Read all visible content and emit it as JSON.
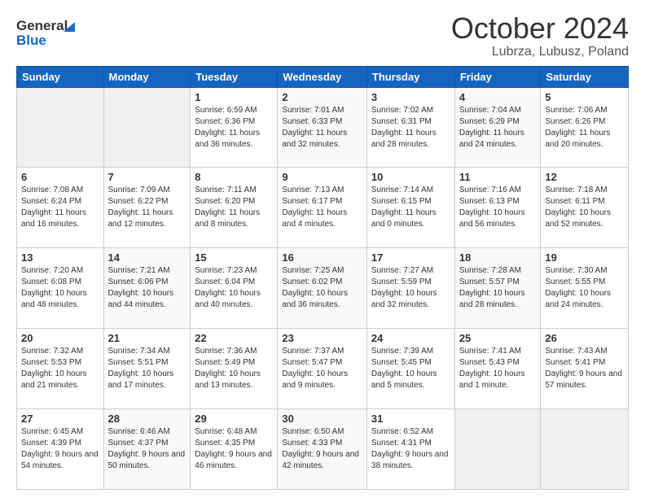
{
  "header": {
    "logo_general": "General",
    "logo_blue": "Blue",
    "title": "October 2024",
    "location": "Lubrza, Lubusz, Poland"
  },
  "days_of_week": [
    "Sunday",
    "Monday",
    "Tuesday",
    "Wednesday",
    "Thursday",
    "Friday",
    "Saturday"
  ],
  "weeks": [
    [
      {
        "day": "",
        "info": ""
      },
      {
        "day": "",
        "info": ""
      },
      {
        "day": "1",
        "info": "Sunrise: 6:59 AM\nSunset: 6:36 PM\nDaylight: 11 hours and 36 minutes."
      },
      {
        "day": "2",
        "info": "Sunrise: 7:01 AM\nSunset: 6:33 PM\nDaylight: 11 hours and 32 minutes."
      },
      {
        "day": "3",
        "info": "Sunrise: 7:02 AM\nSunset: 6:31 PM\nDaylight: 11 hours and 28 minutes."
      },
      {
        "day": "4",
        "info": "Sunrise: 7:04 AM\nSunset: 6:29 PM\nDaylight: 11 hours and 24 minutes."
      },
      {
        "day": "5",
        "info": "Sunrise: 7:06 AM\nSunset: 6:26 PM\nDaylight: 11 hours and 20 minutes."
      }
    ],
    [
      {
        "day": "6",
        "info": "Sunrise: 7:08 AM\nSunset: 6:24 PM\nDaylight: 11 hours and 16 minutes."
      },
      {
        "day": "7",
        "info": "Sunrise: 7:09 AM\nSunset: 6:22 PM\nDaylight: 11 hours and 12 minutes."
      },
      {
        "day": "8",
        "info": "Sunrise: 7:11 AM\nSunset: 6:20 PM\nDaylight: 11 hours and 8 minutes."
      },
      {
        "day": "9",
        "info": "Sunrise: 7:13 AM\nSunset: 6:17 PM\nDaylight: 11 hours and 4 minutes."
      },
      {
        "day": "10",
        "info": "Sunrise: 7:14 AM\nSunset: 6:15 PM\nDaylight: 11 hours and 0 minutes."
      },
      {
        "day": "11",
        "info": "Sunrise: 7:16 AM\nSunset: 6:13 PM\nDaylight: 10 hours and 56 minutes."
      },
      {
        "day": "12",
        "info": "Sunrise: 7:18 AM\nSunset: 6:11 PM\nDaylight: 10 hours and 52 minutes."
      }
    ],
    [
      {
        "day": "13",
        "info": "Sunrise: 7:20 AM\nSunset: 6:08 PM\nDaylight: 10 hours and 48 minutes."
      },
      {
        "day": "14",
        "info": "Sunrise: 7:21 AM\nSunset: 6:06 PM\nDaylight: 10 hours and 44 minutes."
      },
      {
        "day": "15",
        "info": "Sunrise: 7:23 AM\nSunset: 6:04 PM\nDaylight: 10 hours and 40 minutes."
      },
      {
        "day": "16",
        "info": "Sunrise: 7:25 AM\nSunset: 6:02 PM\nDaylight: 10 hours and 36 minutes."
      },
      {
        "day": "17",
        "info": "Sunrise: 7:27 AM\nSunset: 5:59 PM\nDaylight: 10 hours and 32 minutes."
      },
      {
        "day": "18",
        "info": "Sunrise: 7:28 AM\nSunset: 5:57 PM\nDaylight: 10 hours and 28 minutes."
      },
      {
        "day": "19",
        "info": "Sunrise: 7:30 AM\nSunset: 5:55 PM\nDaylight: 10 hours and 24 minutes."
      }
    ],
    [
      {
        "day": "20",
        "info": "Sunrise: 7:32 AM\nSunset: 5:53 PM\nDaylight: 10 hours and 21 minutes."
      },
      {
        "day": "21",
        "info": "Sunrise: 7:34 AM\nSunset: 5:51 PM\nDaylight: 10 hours and 17 minutes."
      },
      {
        "day": "22",
        "info": "Sunrise: 7:36 AM\nSunset: 5:49 PM\nDaylight: 10 hours and 13 minutes."
      },
      {
        "day": "23",
        "info": "Sunrise: 7:37 AM\nSunset: 5:47 PM\nDaylight: 10 hours and 9 minutes."
      },
      {
        "day": "24",
        "info": "Sunrise: 7:39 AM\nSunset: 5:45 PM\nDaylight: 10 hours and 5 minutes."
      },
      {
        "day": "25",
        "info": "Sunrise: 7:41 AM\nSunset: 5:43 PM\nDaylight: 10 hours and 1 minute."
      },
      {
        "day": "26",
        "info": "Sunrise: 7:43 AM\nSunset: 5:41 PM\nDaylight: 9 hours and 57 minutes."
      }
    ],
    [
      {
        "day": "27",
        "info": "Sunrise: 6:45 AM\nSunset: 4:39 PM\nDaylight: 9 hours and 54 minutes."
      },
      {
        "day": "28",
        "info": "Sunrise: 6:46 AM\nSunset: 4:37 PM\nDaylight: 9 hours and 50 minutes."
      },
      {
        "day": "29",
        "info": "Sunrise: 6:48 AM\nSunset: 4:35 PM\nDaylight: 9 hours and 46 minutes."
      },
      {
        "day": "30",
        "info": "Sunrise: 6:50 AM\nSunset: 4:33 PM\nDaylight: 9 hours and 42 minutes."
      },
      {
        "day": "31",
        "info": "Sunrise: 6:52 AM\nSunset: 4:31 PM\nDaylight: 9 hours and 38 minutes."
      },
      {
        "day": "",
        "info": ""
      },
      {
        "day": "",
        "info": ""
      }
    ]
  ]
}
